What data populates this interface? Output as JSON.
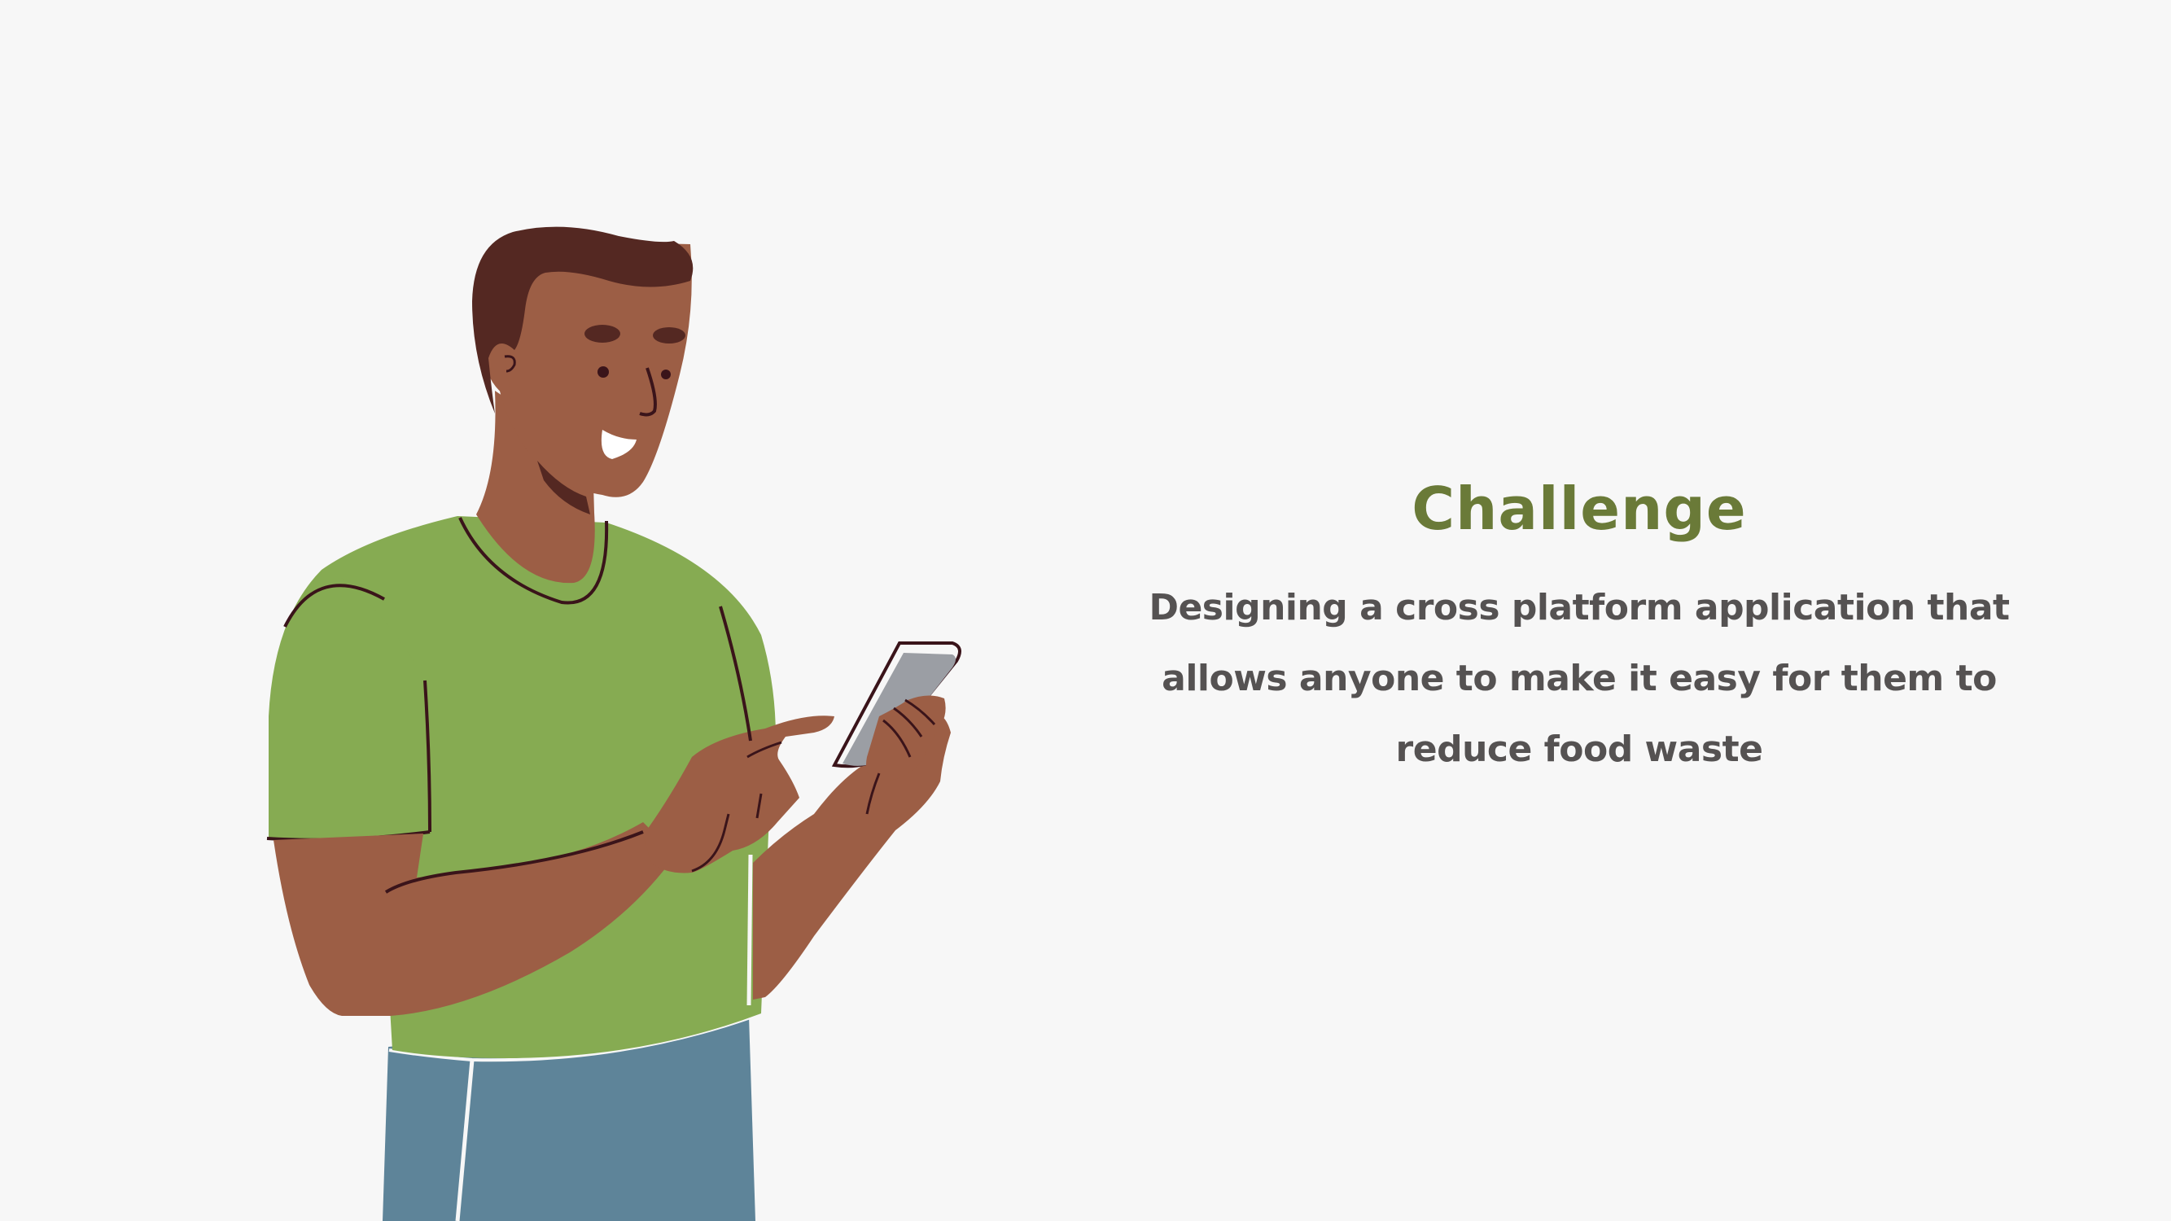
{
  "colors": {
    "background": "#f7f7f7",
    "heading": "#6a7a38",
    "body": "#555252",
    "shirt": "#86ab52",
    "skin": "#9c5e45",
    "hair": "#542822",
    "pants": "#5e8499",
    "phone": "#9b9ea4",
    "outline": "#3a141a"
  },
  "illustration": {
    "icon": "person-using-phone-icon"
  },
  "content": {
    "heading": "Challenge",
    "body_lines": [
      "Designing a cross platform application that",
      "allows anyone to make it easy for them to",
      "reduce food waste"
    ]
  }
}
